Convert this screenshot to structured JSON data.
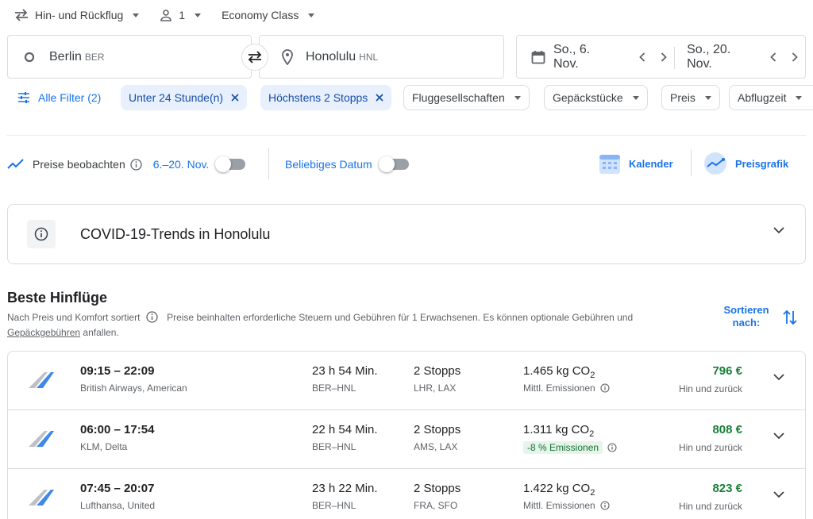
{
  "top": {
    "trip_type": "Hin- und Rückflug",
    "passengers": "1",
    "cabin": "Economy Class"
  },
  "search": {
    "origin": {
      "name": "Berlin",
      "code": "BER"
    },
    "destination": {
      "name": "Honolulu",
      "code": "HNL"
    },
    "depart_date": "So., 6. Nov.",
    "return_date": "So., 20. Nov."
  },
  "filters": {
    "all_filters": "Alle Filter (2)",
    "chips_active": [
      "Unter 24 Stunde(n)",
      "Höchstens 2 Stopps"
    ],
    "chips_dropdown": [
      "Fluggesellschaften",
      "Gepäckstücke",
      "Preis",
      "Abflugzeit"
    ]
  },
  "tracker": {
    "track_prices": "Preise beobachten",
    "date_range": "6.–20. Nov.",
    "any_date": "Beliebiges Datum",
    "calendar": "Kalender",
    "price_graph": "Preisgrafik"
  },
  "covid": {
    "title": "COVID-19-Trends in Honolulu"
  },
  "results": {
    "title": "Beste Hinflüge",
    "sorted_by": "Nach Preis und Komfort sortiert",
    "note": "Preise beinhalten erforderliche Steuern und Gebühren für 1 Erwachsenen. Es können optionale Gebühren und",
    "baggage_link": "Gepäckgebühren",
    "note_end": "anfallen.",
    "sort_label": "Sortieren nach:",
    "co2_unit": "kg CO",
    "co2_sub": "2",
    "flights": [
      {
        "time": "09:15 – 22:09",
        "airlines": "British Airways, American",
        "duration": "23 h 54 Min.",
        "route": "BER–HNL",
        "stops": "2 Stopps",
        "via": "LHR, LAX",
        "co2": "1.465",
        "emission": "Mittl. Emissionen",
        "price": "796 €",
        "price_type": "Hin und zurück"
      },
      {
        "time": "06:00 – 17:54",
        "airlines": "KLM, Delta",
        "duration": "22 h 54 Min.",
        "route": "BER–HNL",
        "stops": "2 Stopps",
        "via": "AMS, LAX",
        "co2": "1.311",
        "emission": "-8 % Emissionen",
        "price": "808 €",
        "price_type": "Hin und zurück"
      },
      {
        "time": "07:45 – 20:07",
        "airlines": "Lufthansa, United",
        "duration": "23 h 22 Min.",
        "route": "BER–HNL",
        "stops": "2 Stopps",
        "via": "FRA, SFO",
        "co2": "1.422",
        "emission": "Mittl. Emissionen",
        "price": "823 €",
        "price_type": "Hin und zurück"
      }
    ]
  },
  "icons": {
    "swap": "swap-horiz-icon",
    "person": "person-icon",
    "origin": "circle-icon",
    "destination": "place-icon",
    "calendar": "calendar-icon",
    "filter": "tune-icon",
    "trend": "trend-icon",
    "info": "info-icon",
    "expand": "chevron-down-icon",
    "sort": "swap-vert-icon"
  },
  "colors": {
    "accent": "#1a73e8",
    "chip_bg": "#e8f0fe",
    "price_green": "#188038",
    "border": "#dadce0"
  }
}
